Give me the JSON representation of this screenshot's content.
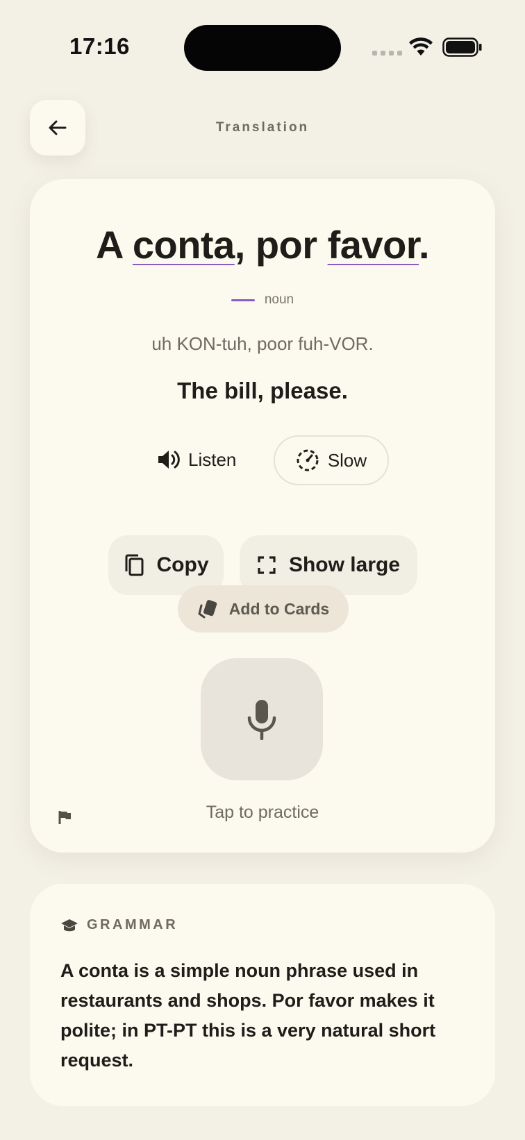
{
  "status": {
    "time": "17:16"
  },
  "header": {
    "title": "Translation",
    "back_icon": "arrow-left-icon"
  },
  "phrase": {
    "segments": [
      {
        "text": "A ",
        "highlight": false
      },
      {
        "text": "conta",
        "highlight": true
      },
      {
        "text": ", por ",
        "highlight": false
      },
      {
        "text": "favor",
        "highlight": true
      },
      {
        "text": ".",
        "highlight": false
      }
    ],
    "legend_label": "noun",
    "legend_color": "#8a5cc2",
    "pronunciation": "uh KON-tuh, poor fuh-VOR.",
    "translation": "The bill, please."
  },
  "audio": {
    "listen_label": "Listen",
    "slow_label": "Slow"
  },
  "actions": {
    "copy_label": "Copy",
    "show_large_label": "Show large",
    "add_cards_label": "Add to Cards"
  },
  "practice": {
    "label": "Tap to practice"
  },
  "grammar": {
    "title": "GRAMMAR",
    "body": "A conta is a simple noun phrase used in restaurants and shops. Por favor makes it polite; in PT-PT this is a very natural short request."
  },
  "colors": {
    "background": "#f3f0e6",
    "card": "#fcf9ee",
    "accent": "#8a5cc2",
    "text": "#1f1d1a",
    "muted": "#6f6a62"
  }
}
